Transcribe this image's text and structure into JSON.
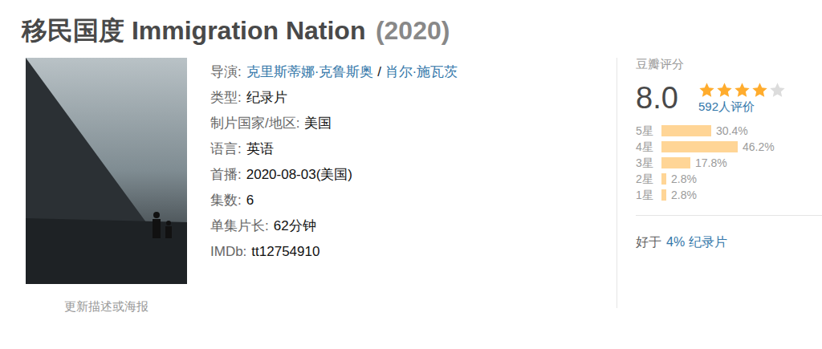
{
  "title": {
    "name": "移民国度 Immigration Nation",
    "year": "(2020)"
  },
  "poster": {
    "caption": "更新描述或海报"
  },
  "info": [
    {
      "label": "导演:",
      "parts": [
        {
          "text": "克里斯蒂娜·克鲁斯奥",
          "link": true
        },
        {
          "text": " / ",
          "link": false
        },
        {
          "text": "肖尔·施瓦茨",
          "link": true
        }
      ]
    },
    {
      "label": "类型:",
      "parts": [
        {
          "text": "纪录片",
          "link": false
        }
      ]
    },
    {
      "label": "制片国家/地区:",
      "parts": [
        {
          "text": "美国",
          "link": false
        }
      ]
    },
    {
      "label": "语言:",
      "parts": [
        {
          "text": "英语",
          "link": false
        }
      ]
    },
    {
      "label": "首播:",
      "parts": [
        {
          "text": "2020-08-03(美国)",
          "link": false
        }
      ]
    },
    {
      "label": "集数:",
      "parts": [
        {
          "text": "6",
          "link": false
        }
      ]
    },
    {
      "label": "单集片长:",
      "parts": [
        {
          "text": "62分钟",
          "link": false
        }
      ]
    },
    {
      "label": "IMDb:",
      "parts": [
        {
          "text": "tt12754910",
          "link": false
        }
      ]
    }
  ],
  "rating": {
    "label": "豆瓣评分",
    "score": "8.0",
    "stars": 4,
    "count": "592人评价",
    "bars": [
      {
        "label": "5星",
        "percent": "30.4%",
        "level": 0.304
      },
      {
        "label": "4星",
        "percent": "46.2%",
        "level": 0.462
      },
      {
        "label": "3星",
        "percent": "17.8%",
        "level": 0.178
      },
      {
        "label": "2星",
        "percent": "2.8%",
        "level": 0.028
      },
      {
        "label": "1星",
        "percent": "2.8%",
        "level": 0.028
      }
    ],
    "better": {
      "prefix": "好于",
      "link": "4% 纪录片"
    }
  }
}
